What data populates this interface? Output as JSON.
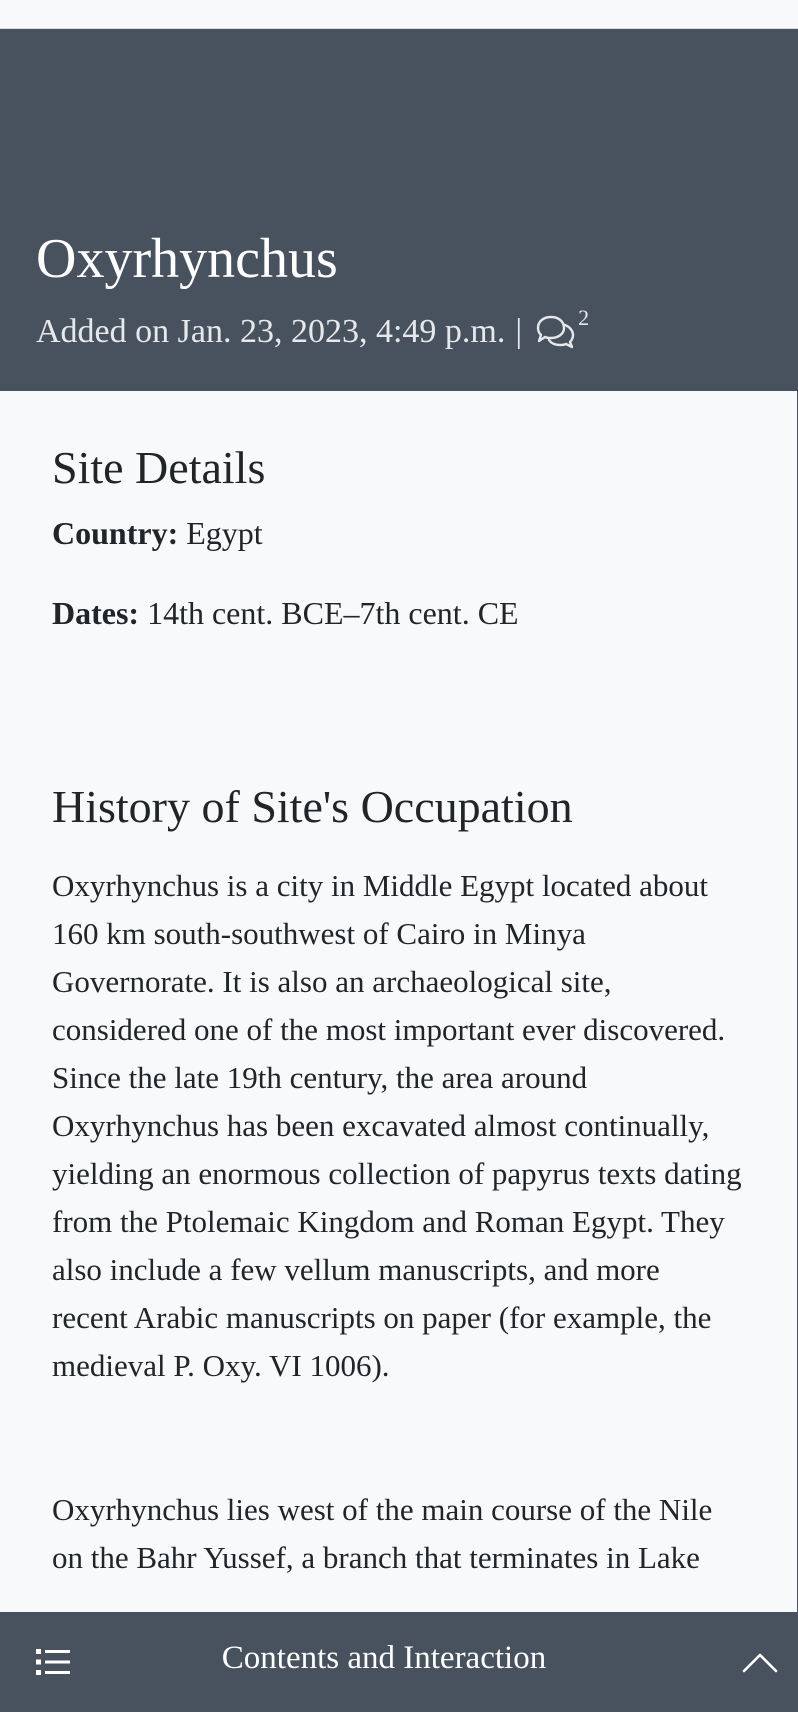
{
  "site": {
    "title": "Oxyrhynchus",
    "added": "Added on Jan. 23, 2023, 4:49 p.m.",
    "separator": "|",
    "comment_icon": "comments-icon",
    "comment_count": "2"
  },
  "details": {
    "heading": "Site Details",
    "country_label": "Country:",
    "country_value": "Egypt",
    "dates_label": "Dates:",
    "dates_value": "14th cent. BCE–7th cent. CE"
  },
  "history": {
    "heading": "History of Site's Occupation",
    "paragraph1": "Oxyrhynchus is a city in Middle Egypt located about 160 km south-southwest of Cairo in Minya Governorate. It is also an archaeological site, considered one of the most important ever discovered. Since the late 19th century, the area around Oxyrhynchus has been excavated almost continually, yielding an enormous collection of papyrus texts dating from the Ptolemaic Kingdom and Roman Egypt. They also include a few vellum manuscripts, and more recent Arabic manuscripts on paper (for example, the medieval P. Oxy. VI 1006).",
    "paragraph2": "Oxyrhynchus lies west of the main course of the Nile on the Bahr Yussef, a branch that terminates in Lake"
  },
  "bottom_bar": {
    "label": "Contents and Interaction",
    "left_icon": "list-icon",
    "right_icon": "chevron-up-icon"
  },
  "colors": {
    "header_bg": "#48525f",
    "page_bg": "#f8f9fb",
    "text": "#212529"
  }
}
